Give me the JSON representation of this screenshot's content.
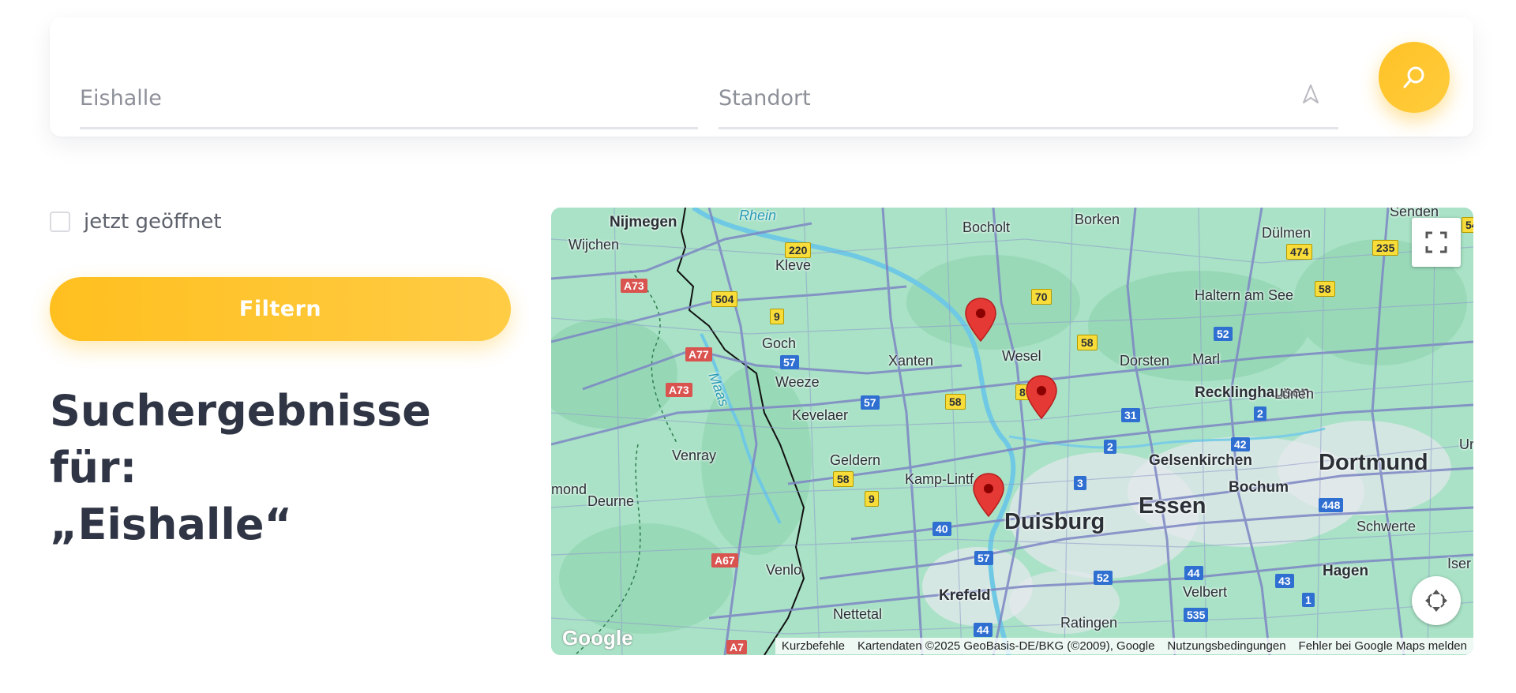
{
  "search": {
    "what_value": "",
    "what_placeholder": "Eishalle",
    "where_value": "",
    "where_placeholder": "Standort",
    "locate_icon": "navigation-arrow-icon",
    "search_icon": "search-icon",
    "accent_color": "#ffc226"
  },
  "filters": {
    "open_now_label": "jetzt geöffnet",
    "open_now_checked": false,
    "filter_button_label": "Filtern"
  },
  "results": {
    "heading_line1": "Suchergebnisse für:",
    "heading_line2": "„Eishalle“"
  },
  "map": {
    "fullscreen_icon": "fullscreen-icon",
    "camera_control_icon": "camera-move-icon",
    "pin_color": "#e53935",
    "labels": {
      "nijmegen": "Nijmegen",
      "wijchen": "Wijchen",
      "kleve": "Kleve",
      "goch": "Goch",
      "weeze": "Weeze",
      "kevelaer": "Kevelaer",
      "venray": "Venray",
      "deurne": "Deurne",
      "mond": "mond",
      "geldern": "Geldern",
      "xanten": "Xanten",
      "wesel": "Wesel",
      "bocholt": "Bocholt",
      "borken": "Borken",
      "senden": "Senden",
      "duelmen": "Dülmen",
      "haltern": "Haltern am See",
      "dorsten": "Dorsten",
      "marl": "Marl",
      "recklinghausen": "Recklinghausen",
      "luenen": "Lünen",
      "gelsenkirchen": "Gelsenkirchen",
      "dortmund": "Dortmund",
      "essen": "Essen",
      "bochum": "Bochum",
      "duisburg": "Duisburg",
      "kamp_lintfort": "Kamp-Lintf",
      "schwerte": "Schwerte",
      "hagen": "Hagen",
      "iser": "Iser",
      "un": "Ur",
      "velbert": "Velbert",
      "ratingen": "Ratingen",
      "krefeld": "Krefeld",
      "nettetal": "Nettetal",
      "venlo": "Venlo",
      "rhein": "Rhein",
      "maas": "Maas"
    },
    "shields": {
      "a73_1": "A73",
      "a77": "A77",
      "a73_2": "A73",
      "a67": "A67",
      "a7": "A7",
      "b220": "220",
      "b504": "504",
      "b9_1": "9",
      "b9_2": "9",
      "b58_1": "58",
      "b58_2": "58",
      "b58_3": "58",
      "b58_4": "58",
      "b70": "70",
      "b8": "8",
      "b474": "474",
      "b235": "235",
      "b54": "54",
      "a57_1": "57",
      "a57_2": "57",
      "a57_3": "57",
      "a52_1": "52",
      "a52_2": "52",
      "a31": "31",
      "a2_1": "2",
      "a2_2": "2",
      "a42": "42",
      "a3": "3",
      "a40": "40",
      "a448": "448",
      "a44_1": "44",
      "a44_2": "44",
      "a43": "43",
      "a535": "535",
      "a1": "1"
    },
    "logo": "Google",
    "footer": {
      "shortcuts": "Kurzbefehle",
      "copyright": "Kartendaten ©2025 GeoBasis-DE/BKG (©2009), Google",
      "terms": "Nutzungsbedingungen",
      "report": "Fehler bei Google Maps melden"
    }
  }
}
